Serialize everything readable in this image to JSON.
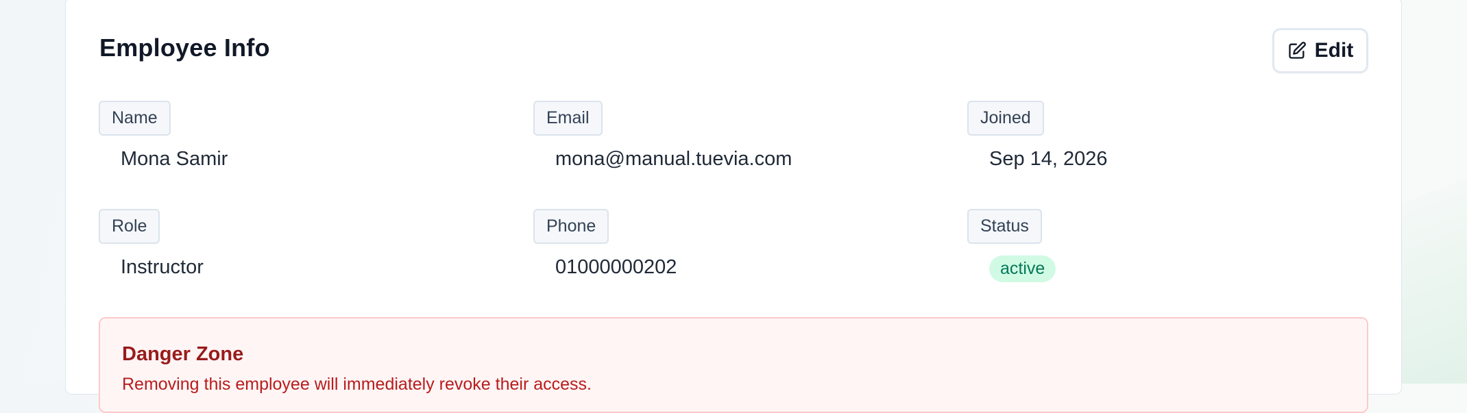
{
  "card": {
    "title": "Employee Info",
    "edit_label": "Edit"
  },
  "fields": {
    "name": {
      "label": "Name",
      "value": "Mona Samir"
    },
    "email": {
      "label": "Email",
      "value": "mona@manual.tuevia.com"
    },
    "joined": {
      "label": "Joined",
      "value": "Sep 14, 2026"
    },
    "role": {
      "label": "Role",
      "value": "Instructor"
    },
    "phone": {
      "label": "Phone",
      "value": "01000000202"
    },
    "status": {
      "label": "Status",
      "value": "active"
    }
  },
  "danger_zone": {
    "title": "Danger Zone",
    "description": "Removing this employee will immediately revoke their access."
  },
  "icons": {
    "edit": "pencil-square-icon"
  },
  "colors": {
    "status_active_bg": "#d1fae5",
    "status_active_text": "#047857",
    "danger_text": "#991b1b",
    "danger_bg": "#fff5f5",
    "danger_border": "#fecaca"
  }
}
